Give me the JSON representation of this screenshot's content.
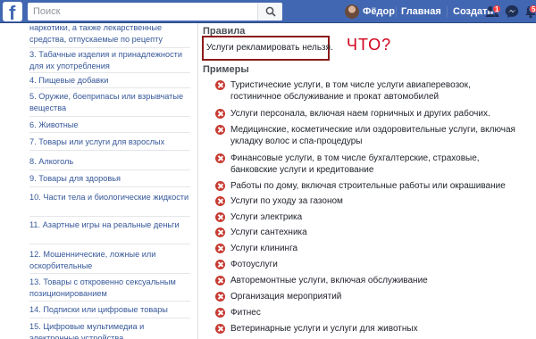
{
  "topbar": {
    "logo": "f",
    "search_placeholder": "Поиск",
    "user_name": "Фёдор",
    "home_label": "Главная",
    "create_label": "Создать",
    "friend_requests_count": "1",
    "notifications_count": "5"
  },
  "sidebar": {
    "items": [
      "наркотики, а также лекарственные средства, отпускаемые по рецепту",
      "3. Табачные изделия и принадлежности для их употребления",
      "4. Пищевые добавки",
      "5. Оружие, боеприпасы или взрывчатые вещества",
      "6. Животные",
      "7. Товары или услуги для взрослых",
      "8. Алкоголь",
      "9. Товары для здоровья",
      "10. Части тела и биологические жидкости",
      "11. Азартные игры на реальные деньги",
      "12. Мошеннические, ложные или оскорбительные",
      "13. Товары с откровенно сексуальным позиционированием",
      "14. Подписки или цифровые товары",
      "15. Цифровые мультимедиа и электронные устройства"
    ]
  },
  "main": {
    "rules_title": "Правила",
    "rule_text": "Услуги рекламировать нельзя.",
    "annotation": "ЧТО?",
    "examples_title": "Примеры",
    "examples": [
      "Туристические услуги, в том числе услуги авиаперевозок, гостиничное обслуживание и прокат автомобилей",
      "Услуги персонала, включая наем горничных и других рабочих.",
      "Медицинские, косметические или оздоровительные услуги, включая укладку волос и спа-процедуры",
      "Финансовые услуги, в том числе бухгалтерские, страховые, банковские услуги и кредитование",
      "Работы по дому, включая строительные работы или окрашивание",
      "Услуги по уходу за газоном",
      "Услуги электрика",
      "Услуги сантехника",
      "Услуги клининга",
      "Фотоуслуги",
      "Авторемонтные услуги, включая обслуживание",
      "Организация мероприятий",
      "Фитнес",
      "Ветеринарные услуги и услуги для животных"
    ]
  },
  "colors": {
    "topbar": "#4267b2",
    "link": "#365899",
    "x_icon": "#c73b32",
    "highlight_box": "#8b1a1a",
    "annotation": "#d0021b"
  }
}
